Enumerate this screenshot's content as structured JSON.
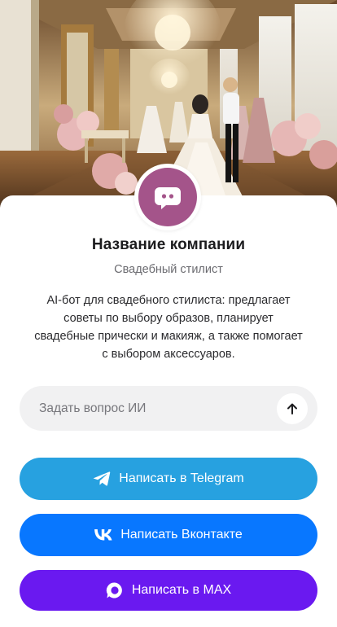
{
  "hero": {
    "image": "wedding-salon-photo-icon"
  },
  "profile": {
    "avatar_icon": "chat-bot-icon",
    "company_name": "Название компании",
    "role": "Свадебный стилист",
    "description": "AI-бот для свадебного стилиста: предлагает советы по выбору образов, планирует свадебные прически и макияж, а также помогает с выбором аксессуаров."
  },
  "ask": {
    "placeholder": "Задать вопрос ИИ",
    "send_icon": "arrow-up-icon"
  },
  "actions": {
    "telegram": {
      "label": "Написать в Telegram",
      "icon": "telegram-icon",
      "color": "#27a1e0"
    },
    "vk": {
      "label": "Написать Вконтакте",
      "icon": "vk-icon",
      "color": "#0877ff"
    },
    "max": {
      "label": "Написать в MAX",
      "icon": "max-icon",
      "color": "#6a19f0"
    }
  },
  "colors": {
    "avatar": "#a4548a",
    "input_bg": "#f1f1f2"
  }
}
